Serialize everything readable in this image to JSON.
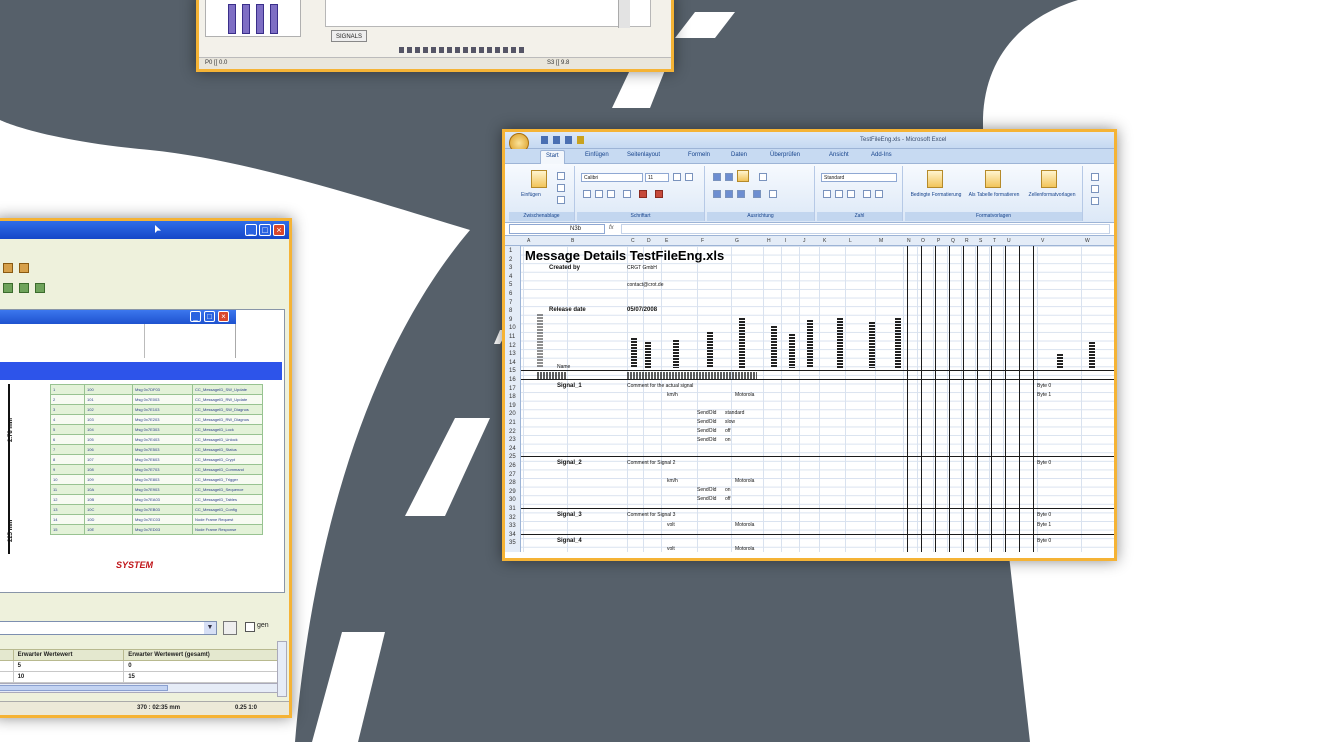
{
  "colors": {
    "road": "#56606a",
    "window_border": "#f5b335",
    "xp_title_blue": "#1547c8",
    "excel_ribbon": "#dce8f7"
  },
  "top_window": {
    "tab_button": "SIGNALS",
    "status_left": "P0 [[ 0.0",
    "status_right": "S3 [[ 9.8"
  },
  "left_window": {
    "controls": {
      "min": "_",
      "max": "□",
      "close": "×"
    },
    "ruler_labels": [
      "2.78 mm",
      "225 mm"
    ],
    "table_rows": [
      [
        "1",
        "100",
        "Msg 0x7DF03",
        "CC_MessageID_SW_Update"
      ],
      [
        "2",
        "101",
        "Msg 0x7E003",
        "CC_MessageID_RW_Update"
      ],
      [
        "3",
        "102",
        "Msg 0x7E103",
        "CC_MessageID_SW_Diagnos"
      ],
      [
        "4",
        "103",
        "Msg 0x7E203",
        "CC_MessageID_RW_Diagnos"
      ],
      [
        "5",
        "104",
        "Msg 0x7E303",
        "CC_MessageID_Lock"
      ],
      [
        "6",
        "105",
        "Msg 0x7E403",
        "CC_MessageID_Unlock"
      ],
      [
        "7",
        "106",
        "Msg 0x7E503",
        "CC_MessageID_Status"
      ],
      [
        "8",
        "107",
        "Msg 0x7E603",
        "CC_MessageID_Crypt"
      ],
      [
        "9",
        "108",
        "Msg 0x7E703",
        "CC_MessageID_Command"
      ],
      [
        "10",
        "109",
        "Msg 0x7E803",
        "CC_MessageID_Trigger"
      ],
      [
        "11",
        "10A",
        "Msg 0x7E903",
        "CC_MessageID_Sequence"
      ],
      [
        "12",
        "10B",
        "Msg 0x7EA03",
        "CC_MessageID_Tables"
      ],
      [
        "13",
        "10C",
        "Msg 0x7EB03",
        "CC_MessageID_Config"
      ],
      [
        "14",
        "10D",
        "Msg 0x7EC03",
        "Node Frame Request"
      ],
      [
        "15",
        "10E",
        "Msg 0x7ED03",
        "Node Frame Response"
      ]
    ],
    "logo": "SYSTEM",
    "checkbox_label": "gen",
    "bottom_table": {
      "headers": [
        "",
        "Erwarter Wertewert",
        "Erwarter Wertewert (gesamt)"
      ],
      "rows": [
        [
          "",
          "5",
          "0"
        ],
        [
          "",
          "10",
          "15"
        ]
      ]
    },
    "status": {
      "left": "370 : 02:35 mm",
      "right": "0.25 1:0"
    }
  },
  "excel": {
    "title": "TestFileEng.xls - Microsoft Excel",
    "tabs": [
      "Start",
      "Einfügen",
      "Seitenlayout",
      "Formeln",
      "Daten",
      "Überprüfen",
      "Ansicht",
      "Add-Ins"
    ],
    "ribbon": {
      "paste": "Einfügen",
      "font_name": "Calibri",
      "font_size": "11",
      "number_format": "Standard",
      "cond_format": "Bedingte Formatierung",
      "format_table": "Als Tabelle formatieren",
      "cell_styles": "Zellenformatvorlagen",
      "groups": [
        "Zwischenablage",
        "Schriftart",
        "Ausrichtung",
        "Zahl",
        "Formatvorlagen"
      ]
    },
    "namebox": "N3b",
    "columns": [
      "A",
      "B",
      "C",
      "D",
      "E",
      "F",
      "G",
      "H",
      "I",
      "J",
      "K",
      "L",
      "M",
      "N",
      "O",
      "P",
      "Q",
      "R",
      "S",
      "T",
      "U",
      "V",
      "W"
    ],
    "rows": [
      "1",
      "2",
      "3",
      "4",
      "5",
      "6",
      "7",
      "8",
      "9",
      "10",
      "11",
      "12",
      "13",
      "14",
      "15",
      "16",
      "17",
      "18",
      "19",
      "20",
      "21",
      "22",
      "23",
      "24",
      "25",
      "26",
      "27",
      "28",
      "29",
      "30",
      "31",
      "32",
      "33",
      "34",
      "35"
    ],
    "sheet": {
      "heading": "Message Details TestFileEng.xls",
      "created_by_label": "Created by",
      "created_by_value": "CRGT GmbH",
      "contact": "contact@crot.de",
      "release_label": "Release date",
      "release_value": "05/07/2008",
      "name_header": "Name",
      "signals": [
        {
          "name": "Signal_1",
          "comment": "Comment for the actual signal"
        },
        {
          "name": "Signal_2",
          "comment": "Comment for Signal 2"
        },
        {
          "name": "Signal_3",
          "comment": "Comment for Signal 3"
        },
        {
          "name": "Signal_4",
          "comment": ""
        }
      ],
      "byte_labels": [
        "Byte 0",
        "Byte 1",
        "Byte 0",
        "Byte 0",
        "Byte 1",
        "Byte 0"
      ],
      "encoding": [
        "Motorola",
        "Motorola",
        "Motorola",
        "Motorola"
      ],
      "units": [
        "km/h",
        "km/h",
        "volt",
        "volt"
      ],
      "values": [
        "SendOld",
        "SendOld",
        "SendOld",
        "SendOld",
        "SendOld",
        "SendOld",
        "SendOld"
      ],
      "value_texts": [
        "standard",
        "slow",
        "off",
        "on",
        "on",
        "off"
      ]
    }
  }
}
